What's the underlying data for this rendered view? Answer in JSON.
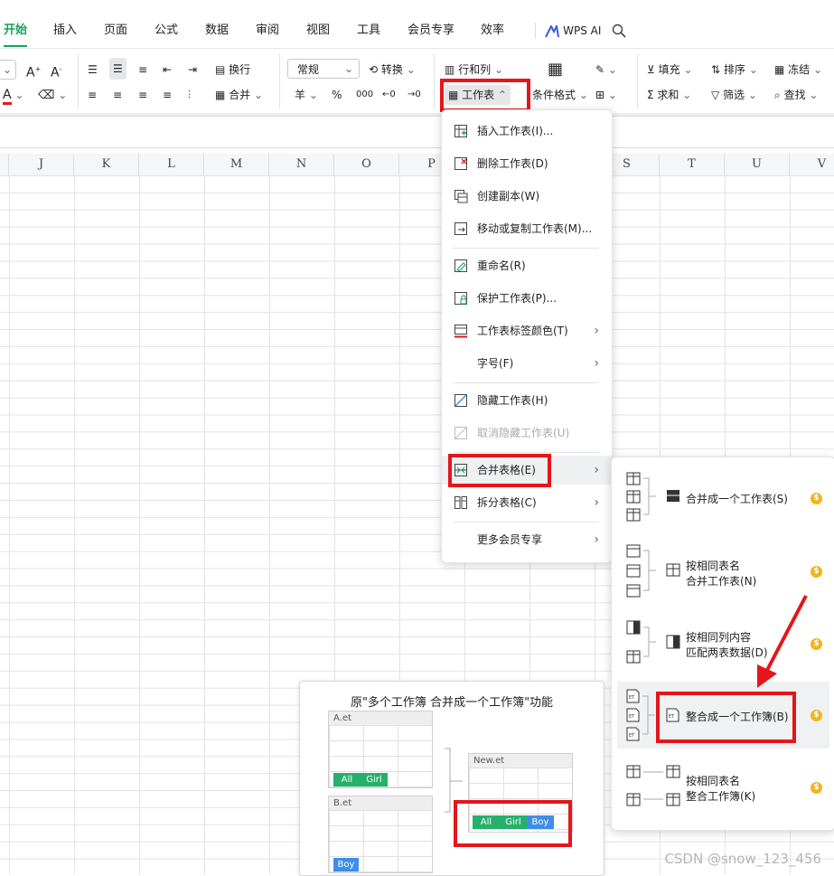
{
  "tabs": [
    "开始",
    "插入",
    "页面",
    "公式",
    "数据",
    "审阅",
    "视图",
    "工具",
    "会员专享",
    "效率",
    "WPS AI"
  ],
  "toolbar": {
    "wrap": "换行",
    "merge": "合并",
    "number_format": "常规",
    "convert": "转换",
    "rows_cols": "行和列",
    "worksheet": "工作表",
    "cond_format": "条件格式",
    "fill": "填充",
    "sort": "排序",
    "freeze": "冻结",
    "sum": "求和",
    "filter": "筛选",
    "find": "查找",
    "currency": "羊",
    "percent": "%"
  },
  "columns": [
    "J",
    "K",
    "L",
    "M",
    "N",
    "O",
    "P",
    "S",
    "T",
    "U",
    "V"
  ],
  "menu": {
    "items": [
      {
        "label": "插入工作表(I)...",
        "icon": "insert-sheet-icon"
      },
      {
        "label": "删除工作表(D)",
        "icon": "delete-sheet-icon"
      },
      {
        "label": "创建副本(W)",
        "icon": "copy-sheet-icon"
      },
      {
        "label": "移动或复制工作表(M)...",
        "icon": "move-copy-icon"
      },
      {
        "label": "重命名(R)",
        "icon": "rename-icon"
      },
      {
        "label": "保护工作表(P)...",
        "icon": "protect-sheet-icon"
      },
      {
        "label": "工作表标签颜色(T)",
        "icon": "tab-color-icon"
      },
      {
        "label": "字号(F)",
        "icon": ""
      },
      {
        "label": "隐藏工作表(H)",
        "icon": "hide-sheet-icon"
      },
      {
        "label": "取消隐藏工作表(U)",
        "icon": "unhide-sheet-icon"
      },
      {
        "label": "合并表格(E)",
        "icon": "merge-tables-icon"
      },
      {
        "label": "拆分表格(C)",
        "icon": "split-tables-icon"
      },
      {
        "label": "更多会员专享",
        "icon": ""
      }
    ]
  },
  "submenu": {
    "items": [
      {
        "line1": "合并成一个工作表(S)",
        "line2": ""
      },
      {
        "line1": "按相同表名",
        "line2": "合并工作表(N)"
      },
      {
        "line1": "按相同列内容",
        "line2": "匹配两表数据(D)"
      },
      {
        "line1": "整合成一个工作簿(B)",
        "line2": ""
      },
      {
        "line1": "按相同表名",
        "line2": "整合工作簿(K)"
      }
    ]
  },
  "preview": {
    "title": "原\"多个工作簿 合并成一个工作簿\"功能",
    "book_a": "A.et",
    "book_b": "B.et",
    "book_new": "New.et",
    "tag_all": "All",
    "tag_girl": "Girl",
    "tag_boy": "Boy"
  },
  "watermark": "CSDN @snow_123_456",
  "colors": {
    "accent": "#17a05d",
    "highlight_red": "#e5161b",
    "coin": "#f3b41b",
    "boy_blue": "#3d8ee8"
  }
}
